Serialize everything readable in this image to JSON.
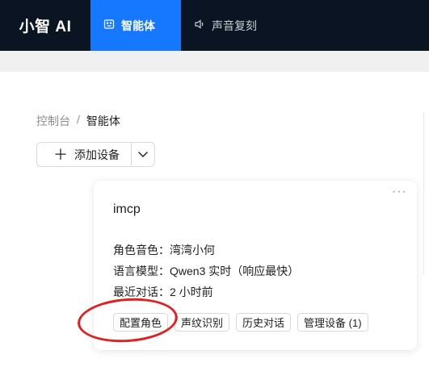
{
  "header": {
    "logo": "小智 AI",
    "nav": [
      {
        "label": "智能体",
        "icon": "robot-icon",
        "active": true
      },
      {
        "label": "声音复刻",
        "icon": "speaker-icon",
        "active": false
      }
    ]
  },
  "breadcrumb": {
    "root": "控制台",
    "separator": "/",
    "current": "智能体"
  },
  "toolbar": {
    "add_label": "添加设备"
  },
  "card": {
    "name": "imcp",
    "more": "···",
    "voice": "角色音色：湾湾小何",
    "model": "语言模型：Qwen3 实时（响应最快）",
    "last_chat": "最近对话：2 小时前",
    "actions": [
      "配置角色",
      "声纹识别",
      "历史对话",
      "管理设备 (1)"
    ]
  },
  "colors": {
    "topbar": "#0b1423",
    "accent": "#1677ff",
    "annotation": "#e02020"
  }
}
